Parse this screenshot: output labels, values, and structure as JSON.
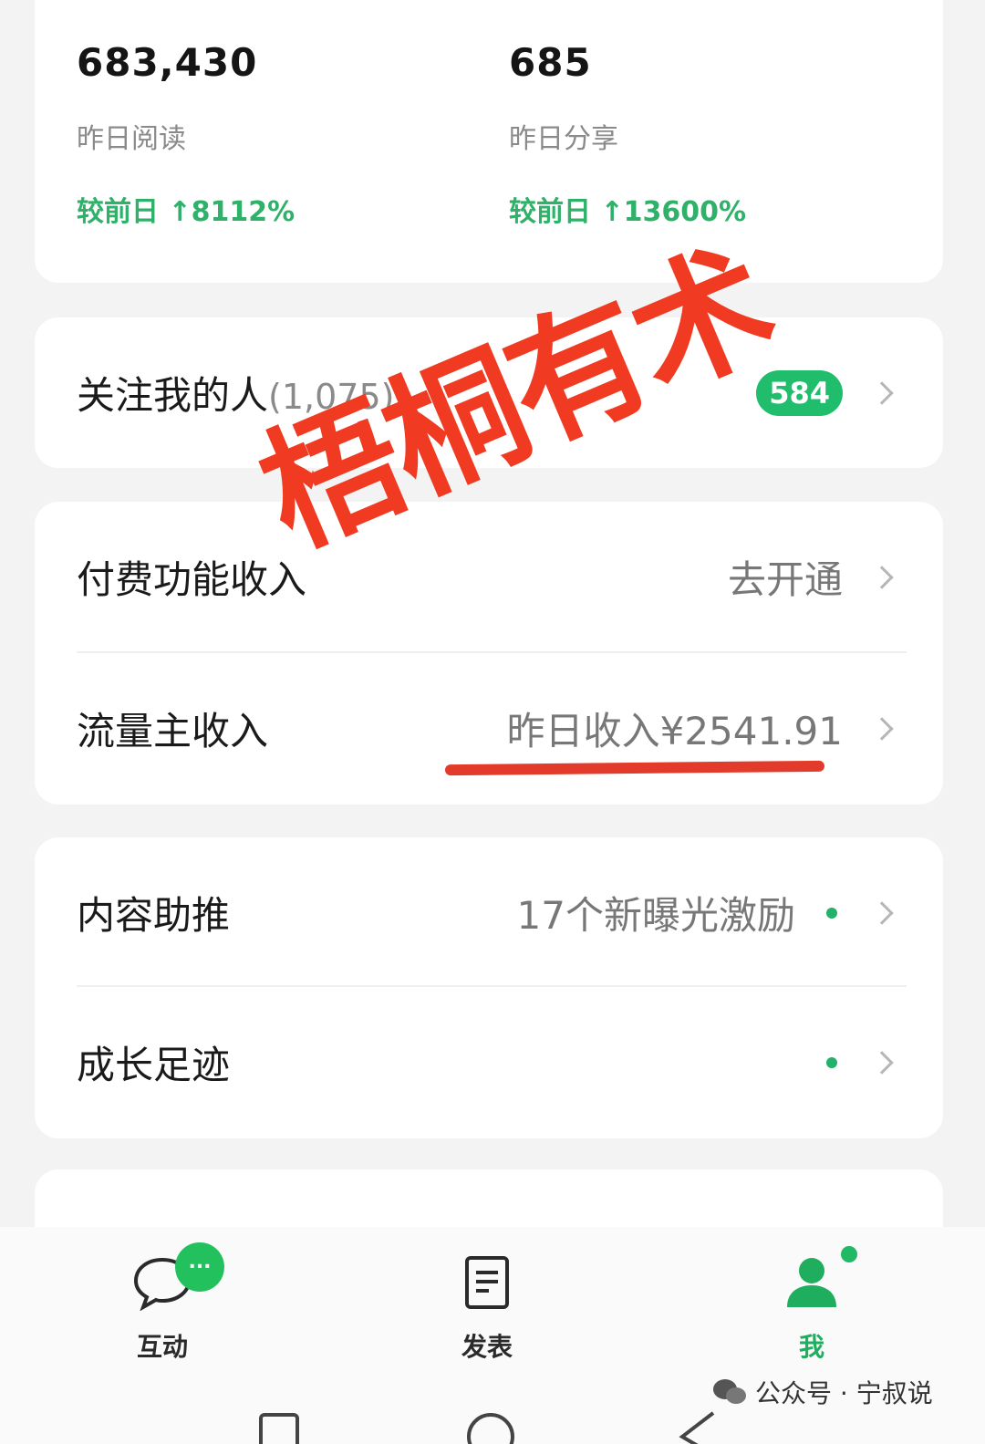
{
  "stats": {
    "reads": {
      "value": "683,430",
      "label": "昨日阅读",
      "change": "较前日 ↑8112%"
    },
    "shares": {
      "value": "685",
      "label": "昨日分享",
      "change": "较前日 ↑13600%"
    }
  },
  "followers": {
    "title": "关注我的人",
    "count": "(1,075)",
    "badge": "584"
  },
  "paid_income": {
    "title": "付费功能收入",
    "value": "去开通"
  },
  "traffic_income": {
    "title": "流量主收入",
    "value": "昨日收入¥2541.91"
  },
  "content_boost": {
    "title": "内容助推",
    "value": "17个新曝光激励"
  },
  "growth": {
    "title": "成长足迹"
  },
  "watermark_text": "梧桐有术",
  "tabs": [
    {
      "label": "互动",
      "icon": "chat-bubble-icon"
    },
    {
      "label": "发表",
      "icon": "document-icon"
    },
    {
      "label": "我",
      "icon": "person-icon"
    }
  ],
  "chat_badge": "...",
  "account_watermark": "公众号 · 宁叔说",
  "colors": {
    "accent_green": "#1fbd6c",
    "watermark_red": "#f03b22",
    "stat_change": "#2fb16a"
  }
}
